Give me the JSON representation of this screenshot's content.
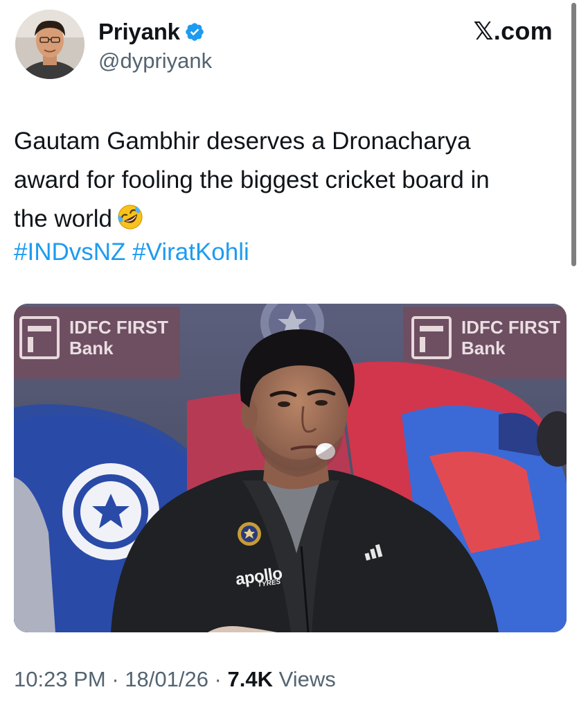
{
  "author": {
    "display_name": "Priyank",
    "handle": "@dypriyank",
    "verified": true,
    "avatar_icon": "user-avatar"
  },
  "brand": {
    "label": "𝕏.com"
  },
  "tweet": {
    "lines": [
      "Gautam Gambhir deserves a Dronacharya",
      "award for fooling the biggest cricket board in",
      "the world"
    ],
    "emoji": "rolling-on-floor-laughing-emoji",
    "hashtags": [
      "#INDvsNZ",
      "#ViratKohli"
    ]
  },
  "media": {
    "sponsor_left": {
      "line1": "IDFC FIRST",
      "line2": "Bank"
    },
    "sponsor_right": {
      "line1": "IDFC FIRST",
      "line2": "Bank"
    },
    "jacket_sponsor": "apollo",
    "jacket_sponsor_sub": "TYRES"
  },
  "meta": {
    "time": "10:23 PM",
    "sep1": " · ",
    "date": "18/01/26",
    "sep2": " · ",
    "views_count": "7.4K",
    "views_label": " Views"
  },
  "colors": {
    "link": "#1d9bf0",
    "verified": "#1d9bf0",
    "secondary_text": "#536471",
    "primary_text": "#0f1419"
  }
}
